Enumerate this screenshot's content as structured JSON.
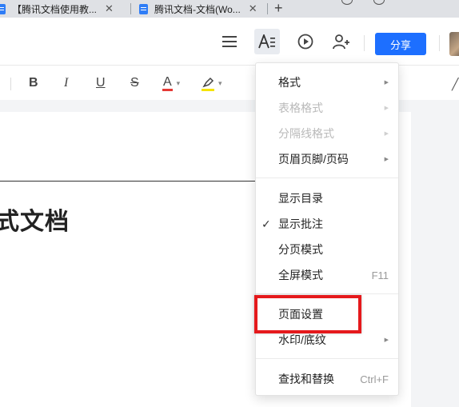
{
  "browser": {
    "tabs": [
      {
        "title": "【腾讯文档使用教...",
        "close": "✕"
      },
      {
        "title": "腾讯文档-文档(Wo...",
        "close": "✕"
      }
    ],
    "new_tab": "+"
  },
  "header": {
    "share_label": "分享",
    "icons": [
      "menu-icon",
      "text-format-icon",
      "play-icon",
      "add-user-icon"
    ]
  },
  "toolbar": {
    "bold": "B",
    "italic": "I",
    "underline": "U",
    "strikethrough": "S",
    "font_color": "A",
    "font_color_swatch": "#e53935",
    "highlight_swatch": "#f5e400",
    "dropdown_caret": "▾"
  },
  "document": {
    "heading_partial": "式文档"
  },
  "menu": {
    "items": [
      {
        "label": "格式",
        "submenu": true,
        "disabled": false
      },
      {
        "label": "表格格式",
        "submenu": true,
        "disabled": true
      },
      {
        "label": "分隔线格式",
        "submenu": true,
        "disabled": true
      },
      {
        "label": "页眉页脚/页码",
        "submenu": true,
        "disabled": false
      },
      {
        "label": "显示目录",
        "disabled": false
      },
      {
        "label": "显示批注",
        "checked": true,
        "disabled": false
      },
      {
        "label": "分页模式",
        "disabled": false
      },
      {
        "label": "全屏模式",
        "shortcut": "F11",
        "disabled": false
      },
      {
        "label": "页面设置",
        "disabled": false
      },
      {
        "label": "水印/底纹",
        "submenu": true,
        "disabled": false
      },
      {
        "label": "查找和替换",
        "shortcut": "Ctrl+F",
        "disabled": false
      }
    ],
    "check_mark": "✓",
    "submenu_arrow": "▶"
  },
  "annotation": {
    "highlight_color": "#e5191c",
    "highlighted_item": "页面设置"
  }
}
